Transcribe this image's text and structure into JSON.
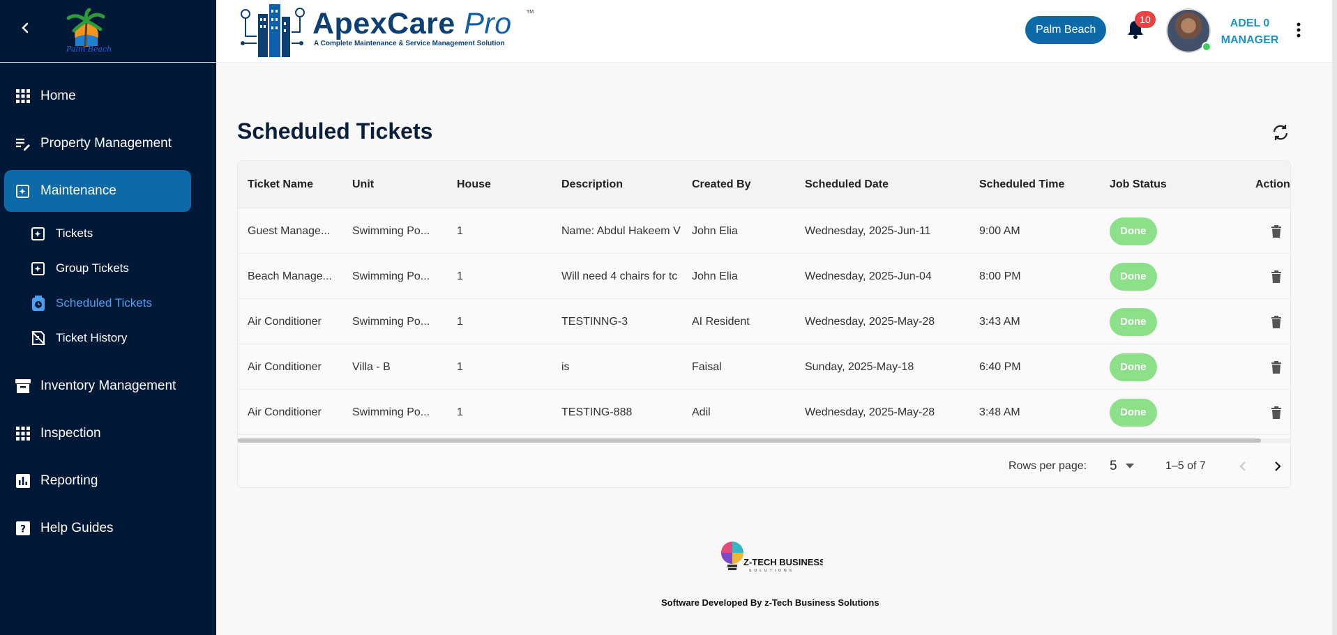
{
  "sidebar": {
    "logo_text": "Palm Beach",
    "nav": [
      {
        "label": "Home",
        "icon": "grid-icon"
      },
      {
        "label": "Property Management",
        "icon": "edit-list-icon"
      },
      {
        "label": "Maintenance",
        "icon": "sparkle-add-icon",
        "active": true
      },
      {
        "label": "Inventory Management",
        "icon": "archive-icon"
      },
      {
        "label": "Inspection",
        "icon": "grid-icon"
      },
      {
        "label": "Reporting",
        "icon": "bar-chart-icon"
      },
      {
        "label": "Help Guides",
        "icon": "help-icon"
      }
    ],
    "maintenance_sub": [
      {
        "label": "Tickets",
        "icon": "sparkle-add-icon"
      },
      {
        "label": "Group Tickets",
        "icon": "sparkle-add-icon"
      },
      {
        "label": "Scheduled Tickets",
        "icon": "clock-icon",
        "active": true
      },
      {
        "label": "Ticket History",
        "icon": "history-icon"
      }
    ]
  },
  "header": {
    "brand_title": "ApexCare",
    "brand_pro": "Pro",
    "brand_tm": "TM",
    "brand_subtitle": "A Complete Maintenance & Service Management Solution",
    "site_button": "Palm Beach",
    "notification_count": "10",
    "user_name": "ADEL 0",
    "user_role": "MANAGER"
  },
  "main": {
    "title": "Scheduled Tickets",
    "columns": [
      "Ticket Name",
      "Unit",
      "House",
      "Description",
      "Created By",
      "Scheduled Date",
      "Scheduled Time",
      "Job Status",
      "Action"
    ],
    "rows": [
      {
        "ticket_name": "Guest Manage...",
        "unit": "Swimming Po...",
        "house": "1",
        "description": "Name: Abdul Hakeem V",
        "created_by": "John Elia",
        "date": "Wednesday, 2025-Jun-11",
        "time": "9:00 AM",
        "status": "Done"
      },
      {
        "ticket_name": "Beach Manage...",
        "unit": "Swimming Po...",
        "house": "1",
        "description": "Will need 4 chairs for tc",
        "created_by": "John Elia",
        "date": "Wednesday, 2025-Jun-04",
        "time": "8:00 PM",
        "status": "Done"
      },
      {
        "ticket_name": "Air Conditioner",
        "unit": "Swimming Po...",
        "house": "1",
        "description": "TESTINNG-3",
        "created_by": "AI Resident",
        "date": "Wednesday, 2025-May-28",
        "time": "3:43 AM",
        "status": "Done"
      },
      {
        "ticket_name": "Air Conditioner",
        "unit": "Villa - B",
        "house": "1",
        "description": "is",
        "created_by": "Faisal",
        "date": "Sunday, 2025-May-18",
        "time": "6:40 PM",
        "status": "Done"
      },
      {
        "ticket_name": "Air Conditioner",
        "unit": "Swimming Po...",
        "house": "1",
        "description": "TESTING-888",
        "created_by": "Adil",
        "date": "Wednesday, 2025-May-28",
        "time": "3:48 AM",
        "status": "Done"
      }
    ],
    "pagination": {
      "rows_per_page_label": "Rows per page:",
      "rows_per_page": "5",
      "range": "1–5 of 7"
    }
  },
  "footer": {
    "logo_text": "Z-TECH BUSINESS",
    "logo_subtext": "SOLUTIONS",
    "credit": "Software Developed By z-Tech Business Solutions"
  },
  "colors": {
    "sidebar_bg": "#011837",
    "accent": "#0b6aa7",
    "active_sub": "#4d9ff0",
    "status_done": "#8ce08a",
    "badge": "#e94343"
  }
}
